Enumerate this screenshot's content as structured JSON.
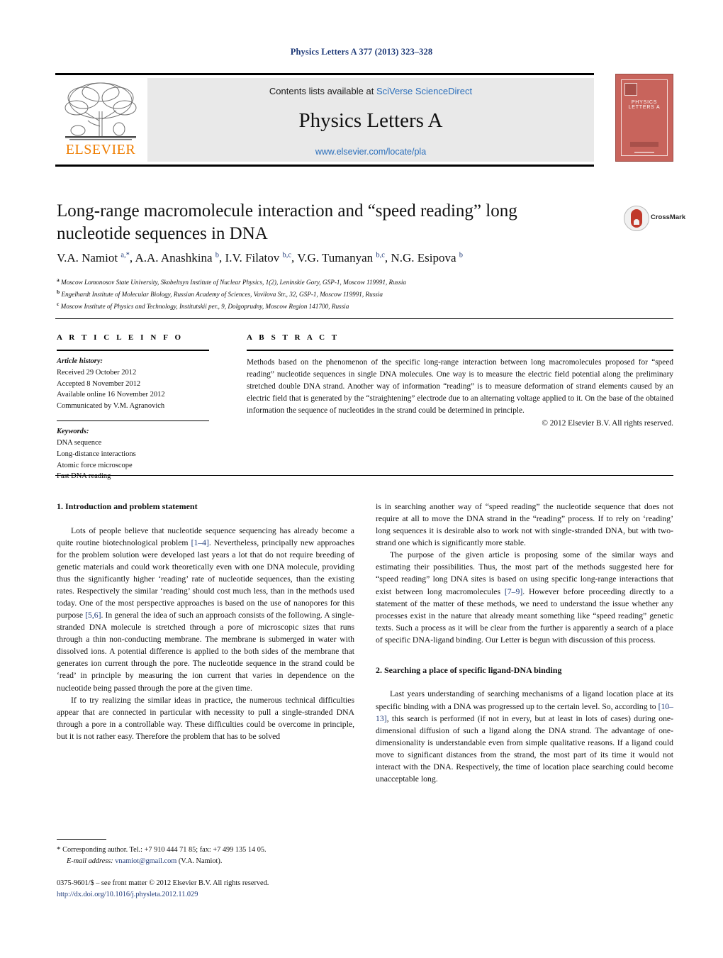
{
  "running_head": "Physics Letters A 377 (2013) 323–328",
  "header": {
    "contents_prefix": "Contents lists available at ",
    "contents_link": "SciVerse ScienceDirect",
    "journal_title": "Physics Letters A",
    "journal_url": "www.elsevier.com/locate/pla",
    "publisher_wordmark": "ELSEVIER",
    "cover_title": "PHYSICS LETTERS A",
    "link_color": "#2a6ebb"
  },
  "article": {
    "title": "Long-range macromolecule interaction and “speed reading” long nucleotide sequences in DNA",
    "crossmark_label": "CrossMark",
    "authors_html": "V.A. Namiot <sup>a,*</sup>, A.A. Anashkina <sup>b</sup>, I.V. Filatov <sup>b,c</sup>, V.G. Tumanyan <sup>b,c</sup>, N.G. Esipova <sup>b</sup>",
    "affiliations": [
      {
        "marker": "a",
        "text": "Moscow Lomonosov State University, Skobeltsyn Institute of Nuclear Physics, 1(2), Leninskie Gory, GSP-1, Moscow 119991, Russia"
      },
      {
        "marker": "b",
        "text": "Engelhardt Institute of Molecular Biology, Russian Academy of Sciences, Vavilova Str., 32, GSP-1, Moscow 119991, Russia"
      },
      {
        "marker": "c",
        "text": "Moscow Institute of Physics and Technology, Institutskii per., 9, Dolgoprudny, Moscow Region 141700, Russia"
      }
    ]
  },
  "article_info": {
    "heading": "A R T I C L E    I N F O",
    "history_label": "Article history:",
    "history": [
      "Received 29 October 2012",
      "Accepted 8 November 2012",
      "Available online 16 November 2012",
      "Communicated by V.M. Agranovich"
    ],
    "keywords_label": "Keywords:",
    "keywords": [
      "DNA sequence",
      "Long-distance interactions",
      "Atomic force microscope",
      "Fast DNA reading"
    ]
  },
  "abstract": {
    "heading": "A B S T R A C T",
    "body": "Methods based on the phenomenon of the specific long-range interaction between long macromolecules proposed for “speed reading” nucleotide sequences in single DNA molecules. One way is to measure the electric field potential along the preliminary stretched double DNA strand. Another way of information “reading” is to measure deformation of strand elements caused by an electric field that is generated by the “straightening” electrode due to an alternating voltage applied to it. On the base of the obtained information the sequence of nucleotides in the strand could be determined in principle.",
    "copyright": "© 2012 Elsevier B.V. All rights reserved."
  },
  "body": {
    "left": {
      "section1_heading": "1. Introduction and problem statement",
      "p1_part1": "Lots of people believe that nucleotide sequence sequencing has already become a quite routine biotechnological problem ",
      "p1_ref1": "[1–4]",
      "p1_part2": ". Nevertheless, principally new approaches for the problem solution were developed last years a lot that do not require breeding of genetic materials and could work theoretically even with one DNA molecule, providing thus the significantly higher ‘reading’ rate of nucleotide sequences, than the existing rates. Respectively the similar ‘reading’ should cost much less, than in the methods used today. One of the most perspective approaches is based on the use of nanopores for this purpose ",
      "p1_ref2": "[5,6]",
      "p1_part3": ". In general the idea of such an approach consists of the following. A single-stranded DNA molecule is stretched through a pore of microscopic sizes that runs through a thin non-conducting membrane. The membrane is submerged in water with dissolved ions. A potential difference is applied to the both sides of the membrane that generates ion current through the pore. The nucleotide sequence in the strand could be ‘read’ in principle by measuring the ion current that varies in dependence on the nucleotide being passed through the pore at the given time.",
      "p2": "If to try realizing the similar ideas in practice, the numerous technical difficulties appear that are connected in particular with necessity to pull a single-stranded DNA through a pore in a controllable way. These difficulties could be overcome in principle, but it is not rather easy. Therefore the problem that has to be solved"
    },
    "right": {
      "p1": "is in searching another way of “speed reading” the nucleotide sequence that does not require at all to move the DNA strand in the “reading” process. If to rely on ‘reading’ long sequences it is desirable also to work not with single-stranded DNA, but with two-strand one which is significantly more stable.",
      "p2_part1": "The purpose of the given article is proposing some of the similar ways and estimating their possibilities. Thus, the most part of the methods suggested here for “speed reading” long DNA sites is based on using specific long-range interactions that exist between long macromolecules ",
      "p2_ref1": "[7–9]",
      "p2_part2": ". However before proceeding directly to a statement of the matter of these methods, we need to understand the issue whether any processes exist in the nature that already meant something like “speed reading” genetic texts. Such a process as it will be clear from the further is apparently a search of a place of specific DNA-ligand binding. Our Letter is begun with discussion of this process.",
      "section2_heading": "2. Searching a place of specific ligand-DNA binding",
      "p3_part1": "Last years understanding of searching mechanisms of a ligand location place at its specific binding with a DNA was progressed up to the certain level. So, according to ",
      "p3_ref1": "[10–13]",
      "p3_part2": ", this search is performed (if not in every, but at least in lots of cases) during one-dimensional diffusion of such a ligand along the DNA strand. The advantage of one-dimensionality is understandable even from simple qualitative reasons. If a ligand could move to significant distances from the strand, the most part of its time it would not interact with the DNA. Respectively, the time of location place searching could become unacceptable long."
    }
  },
  "footnote": {
    "star": "*",
    "corresponding": "Corresponding author. Tel.: +7 910 444 71 85; fax: +7 499 135 14 05.",
    "email_label": "E-mail address:",
    "email": "vnamiot@gmail.com",
    "email_owner": "(V.A. Namiot)."
  },
  "imprint": {
    "line1": "0375-9601/$ – see front matter © 2012 Elsevier B.V. All rights reserved.",
    "doi": "http://dx.doi.org/10.1016/j.physleta.2012.11.029"
  }
}
